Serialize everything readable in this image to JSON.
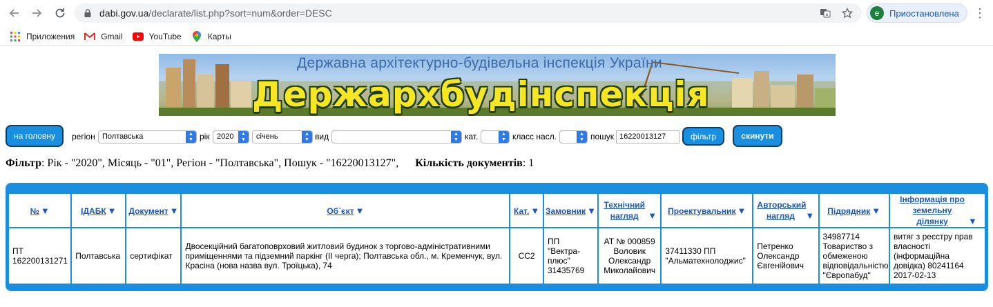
{
  "browser": {
    "url_host": "dabi.gov.ua",
    "url_path": "/declarate/list.php?sort=num&order=DESC",
    "profile_initial": "e",
    "profile_label": "Приостановлена"
  },
  "bookmarks": [
    {
      "label": "Приложения",
      "icon": "apps-grid-icon"
    },
    {
      "label": "Gmail",
      "icon": "gmail-icon"
    },
    {
      "label": "YouTube",
      "icon": "youtube-icon"
    },
    {
      "label": "Карты",
      "icon": "maps-icon"
    }
  ],
  "banner": {
    "small_title": "Державна архітектурно-будівельна інспекція України",
    "big_title": "Держархбудінспекція України"
  },
  "filters": {
    "home_button": "на головну",
    "region_label": "регіон",
    "region_value": "Полтавська",
    "year_label": "рік",
    "year_value": "2020",
    "month_value": "січень",
    "kind_label": "вид",
    "kind_value": "",
    "cat_label": "кат.",
    "cat_value": "",
    "class_label": "класс насл.",
    "class_value": "",
    "search_label": "пошук",
    "search_value": "16220013127",
    "filter_button": "фільтр",
    "reset_button": "скинути"
  },
  "summary": {
    "filter_label": "Фільтр",
    "filter_text": ": Рік - \"2020\", Місяць - \"01\", Регіон - \"Полтавська\", Пошук - \"16220013127\",",
    "count_label": "Кількість документів",
    "count_value": ": 1"
  },
  "table": {
    "headers": [
      "№",
      "ІДАБК",
      "Документ",
      "Об`єкт",
      "Кат.",
      "Замовник",
      "Технічний нагляд",
      "Проектувальник",
      "Авторський нагляд",
      "Підрядник",
      "Інформація про земельну ділянку"
    ],
    "rows": [
      [
        "ПТ 162200131271",
        "Полтавська",
        "сертифікат",
        "Двосекційний багатоповрховий житловий будинок з торгово-адміністративними приміщеннями та підземний паркінг (ІІ черга); Полтавська обл., м. Кременчук, вул. Красіна (нова назва вул. Троїцька), 74",
        "СС2",
        "ПП \"Вектра-плюс\" 31435769",
        "АТ № 000859 Воловик Олександр Миколайович",
        "37411330 ПП \"Альматехнолоджис\"",
        "Петренко Олександр Євгенійович",
        "34987714 Товариство з обмеженою відповідальністю \"Європабуд\"",
        "витяг з реєстру прав власності (інформаційна довідка) 80241164 2017-02-13"
      ]
    ]
  }
}
